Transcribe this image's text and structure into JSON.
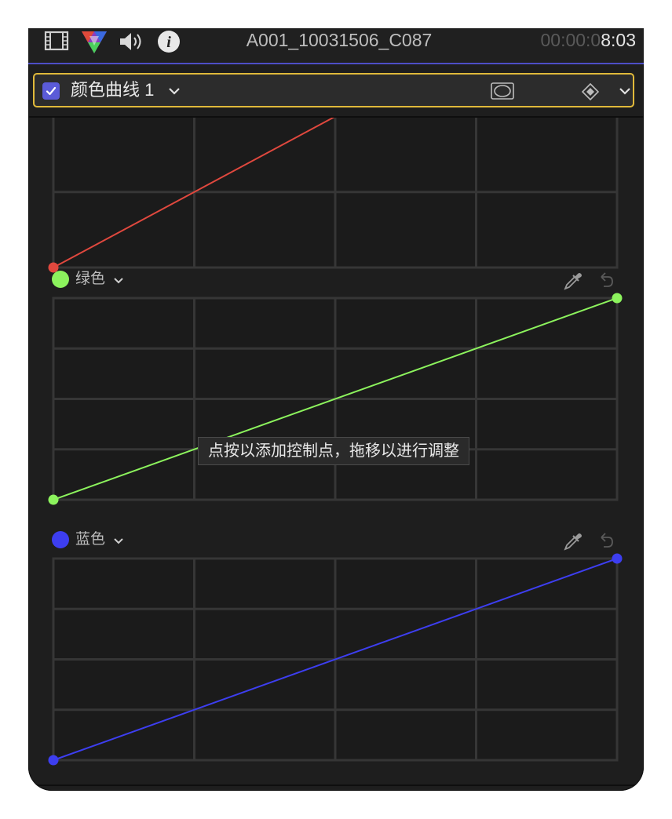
{
  "header": {
    "clip_name": "A001_10031506_C087",
    "timecode_dim": "00:00:0",
    "timecode_bright": "8:03",
    "icons": [
      "film-strip-icon",
      "color-inspector-icon",
      "audio-icon",
      "info-icon"
    ]
  },
  "effect": {
    "enabled": true,
    "name": "颜色曲线 1",
    "accent_color": "#e0b93a",
    "checkbox_color": "#5b5bd8"
  },
  "channels": [
    {
      "id": "red",
      "label": "",
      "color": "#e0483e",
      "start": [
        0,
        0
      ],
      "end": [
        1,
        1
      ]
    },
    {
      "id": "green",
      "label": "绿色",
      "color": "#8cf35d",
      "start": [
        0,
        0
      ],
      "end": [
        1,
        1
      ]
    },
    {
      "id": "blue",
      "label": "蓝色",
      "color": "#3d3ef0",
      "start": [
        0,
        0
      ],
      "end": [
        1,
        1
      ]
    }
  ],
  "tooltip": {
    "text": "点按以添加控制点，拖移以进行调整"
  }
}
